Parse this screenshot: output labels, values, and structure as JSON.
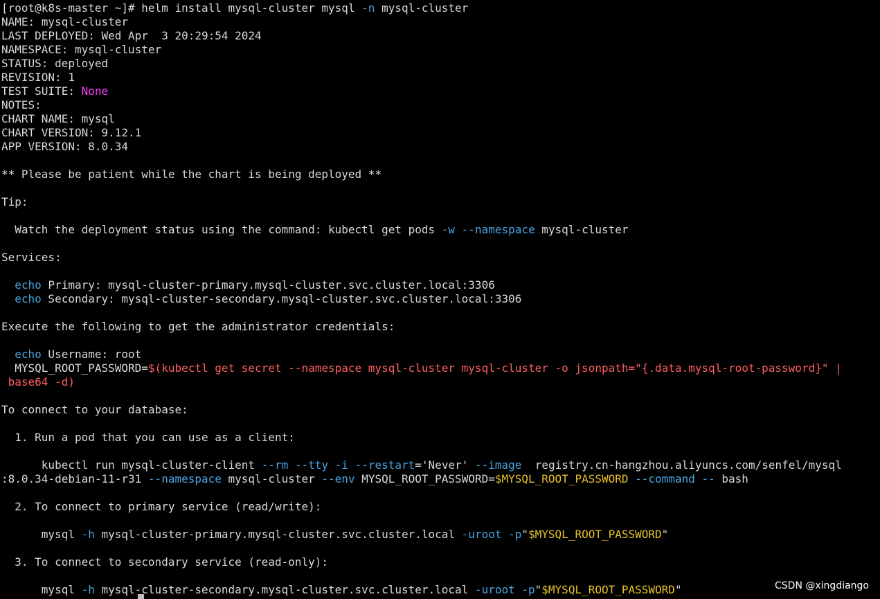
{
  "colors": {
    "background": "#000000",
    "text": "#d9d9d9",
    "flag": "#49a3e0",
    "keyword": "#49a3e0",
    "string": "#ff5f5f",
    "variable": "#e6c229",
    "none": "#ff40ff",
    "watermark": "#ffffff"
  },
  "terminal": {
    "lines": [
      [
        {
          "t": "[root@k8s-master ~]# helm install mysql-cluster mysql "
        },
        {
          "t": "-n",
          "c": "flag"
        },
        {
          "t": " mysql-cluster"
        }
      ],
      [
        {
          "t": "NAME: mysql-cluster"
        }
      ],
      [
        {
          "t": "LAST DEPLOYED: Wed Apr  3 20:29:54 2024"
        }
      ],
      [
        {
          "t": "NAMESPACE: mysql-cluster"
        }
      ],
      [
        {
          "t": "STATUS: deployed"
        }
      ],
      [
        {
          "t": "REVISION: 1"
        }
      ],
      [
        {
          "t": "TEST SUITE: "
        },
        {
          "t": "None",
          "c": "none"
        }
      ],
      [
        {
          "t": "NOTES:"
        }
      ],
      [
        {
          "t": "CHART NAME: mysql"
        }
      ],
      [
        {
          "t": "CHART VERSION: 9.12.1"
        }
      ],
      [
        {
          "t": "APP VERSION: 8.0.34"
        }
      ],
      [],
      [
        {
          "t": "** Please be patient while the chart is being deployed **"
        }
      ],
      [],
      [
        {
          "t": "Tip:"
        }
      ],
      [],
      [
        {
          "t": "  Watch the deployment status using the command: kubectl get pods "
        },
        {
          "t": "-w",
          "c": "flag"
        },
        {
          "t": " "
        },
        {
          "t": "--namespace",
          "c": "flag"
        },
        {
          "t": " mysql-cluster"
        }
      ],
      [],
      [
        {
          "t": "Services:"
        }
      ],
      [],
      [
        {
          "t": "  "
        },
        {
          "t": "echo",
          "c": "kw"
        },
        {
          "t": " Primary: mysql-cluster-primary.mysql-cluster.svc.cluster.local:3306"
        }
      ],
      [
        {
          "t": "  "
        },
        {
          "t": "echo",
          "c": "kw"
        },
        {
          "t": " Secondary: mysql-cluster-secondary.mysql-cluster.svc.cluster.local:3306"
        }
      ],
      [],
      [
        {
          "t": "Execute the following to get the administrator credentials:"
        }
      ],
      [],
      [
        {
          "t": "  "
        },
        {
          "t": "echo",
          "c": "kw"
        },
        {
          "t": " Username: root"
        }
      ],
      [
        {
          "t": "  MYSQL_ROOT_PASSWORD="
        },
        {
          "t": "$(kubectl get secret --namespace mysql-cluster mysql-cluster -o jsonpath=\"{.data.mysql-root-password}\" |",
          "c": "str"
        }
      ],
      [
        {
          "t": " base64 -d)",
          "c": "str"
        }
      ],
      [],
      [
        {
          "t": "To connect to your database:"
        }
      ],
      [],
      [
        {
          "t": "  1. Run a pod that you can use as a client:"
        }
      ],
      [],
      [
        {
          "t": "      kubectl run mysql-cluster-client "
        },
        {
          "t": "--rm",
          "c": "flag"
        },
        {
          "t": " "
        },
        {
          "t": "--tty",
          "c": "flag"
        },
        {
          "t": " "
        },
        {
          "t": "-i",
          "c": "flag"
        },
        {
          "t": " "
        },
        {
          "t": "--restart",
          "c": "flag"
        },
        {
          "t": "='Never' "
        },
        {
          "t": "--image",
          "c": "flag"
        },
        {
          "t": "  registry.cn-hangzhou.aliyuncs.com/senfel/mysql"
        }
      ],
      [
        {
          "t": ":8.0.34-debian-11-r31 "
        },
        {
          "t": "--namespace",
          "c": "flag"
        },
        {
          "t": " mysql-cluster "
        },
        {
          "t": "--env",
          "c": "flag"
        },
        {
          "t": " MYSQL_ROOT_PASSWORD="
        },
        {
          "t": "$MYSQL_ROOT_PASSWORD",
          "c": "var"
        },
        {
          "t": " "
        },
        {
          "t": "--command",
          "c": "flag"
        },
        {
          "t": " "
        },
        {
          "t": "--",
          "c": "flag"
        },
        {
          "t": " bash"
        }
      ],
      [],
      [
        {
          "t": "  2. To connect to primary service (read/write):"
        }
      ],
      [],
      [
        {
          "t": "      mysql "
        },
        {
          "t": "-h",
          "c": "flag"
        },
        {
          "t": " mysql-cluster-primary.mysql-cluster.svc.cluster.local "
        },
        {
          "t": "-uroot",
          "c": "flag"
        },
        {
          "t": " "
        },
        {
          "t": "-p",
          "c": "flag"
        },
        {
          "t": "\""
        },
        {
          "t": "$MYSQL_ROOT_PASSWORD",
          "c": "var"
        },
        {
          "t": "\""
        }
      ],
      [],
      [
        {
          "t": "  3. To connect to secondary service (read-only):"
        }
      ],
      [],
      [
        {
          "t": "      mysql "
        },
        {
          "t": "-h",
          "c": "flag"
        },
        {
          "t": " mysql-cluster-secondary.mysql-cluster.svc.cluster.local "
        },
        {
          "t": "-uroot",
          "c": "flag"
        },
        {
          "t": " "
        },
        {
          "t": "-p",
          "c": "flag"
        },
        {
          "t": "\""
        },
        {
          "t": "$MYSQL_ROOT_PASSWORD",
          "c": "var"
        },
        {
          "t": "\""
        }
      ]
    ]
  },
  "watermark": {
    "text": "CSDN @xingdiango"
  }
}
